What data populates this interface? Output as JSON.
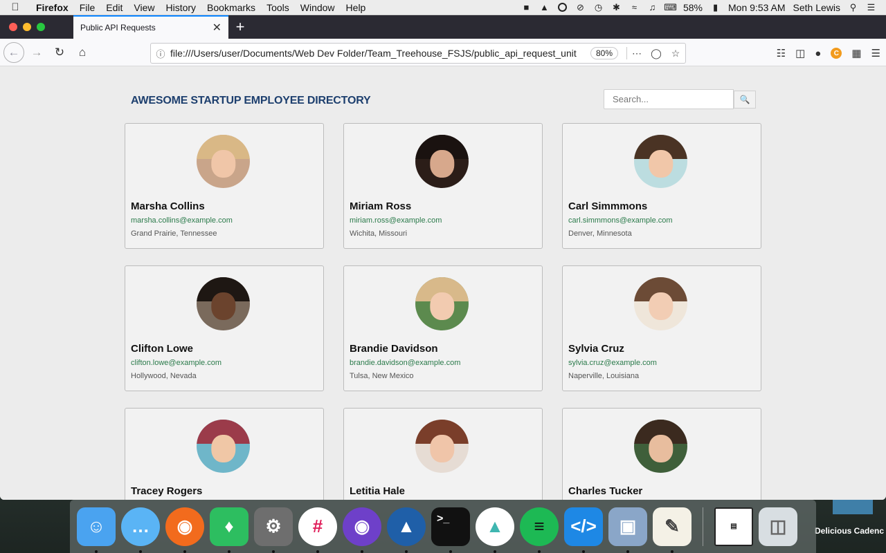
{
  "menubar": {
    "app_name": "Firefox",
    "menus": [
      "File",
      "Edit",
      "View",
      "History",
      "Bookmarks",
      "Tools",
      "Window",
      "Help"
    ],
    "battery": "58%",
    "clock": "Mon 9:53 AM",
    "user": "Seth Lewis"
  },
  "browser": {
    "tab_title": "Public API Requests",
    "url": "file:///Users/user/Documents/Web Dev Folder/Team_Treehouse_FSJS/public_api_request_unit",
    "zoom": "80%"
  },
  "page": {
    "title": "AWESOME STARTUP EMPLOYEE DIRECTORY",
    "search_placeholder": "Search...",
    "employees": [
      {
        "name": "Marsha Collins",
        "email": "marsha.collins@example.com",
        "location": "Grand Prairie, Tennessee"
      },
      {
        "name": "Miriam Ross",
        "email": "miriam.ross@example.com",
        "location": "Wichita, Missouri"
      },
      {
        "name": "Carl Simmmons",
        "email": "carl.simmmons@example.com",
        "location": "Denver, Minnesota"
      },
      {
        "name": "Clifton Lowe",
        "email": "clifton.lowe@example.com",
        "location": "Hollywood, Nevada"
      },
      {
        "name": "Brandie Davidson",
        "email": "brandie.davidson@example.com",
        "location": "Tulsa, New Mexico"
      },
      {
        "name": "Sylvia Cruz",
        "email": "sylvia.cruz@example.com",
        "location": "Naperville, Louisiana"
      },
      {
        "name": "Tracey Rogers",
        "email": "",
        "location": ""
      },
      {
        "name": "Letitia Hale",
        "email": "",
        "location": ""
      },
      {
        "name": "Charles Tucker",
        "email": "",
        "location": ""
      }
    ]
  },
  "desktop": {
    "label": "Delicious Cadenc"
  },
  "dock_apps": [
    "finder",
    "messages",
    "firefox",
    "evernote",
    "system-preferences",
    "slack",
    "github-desktop",
    "mountain-app",
    "terminal",
    "nordvpn",
    "spotify",
    "vscode",
    "preview",
    "textedit",
    "screenshot-stack",
    "trash"
  ]
}
